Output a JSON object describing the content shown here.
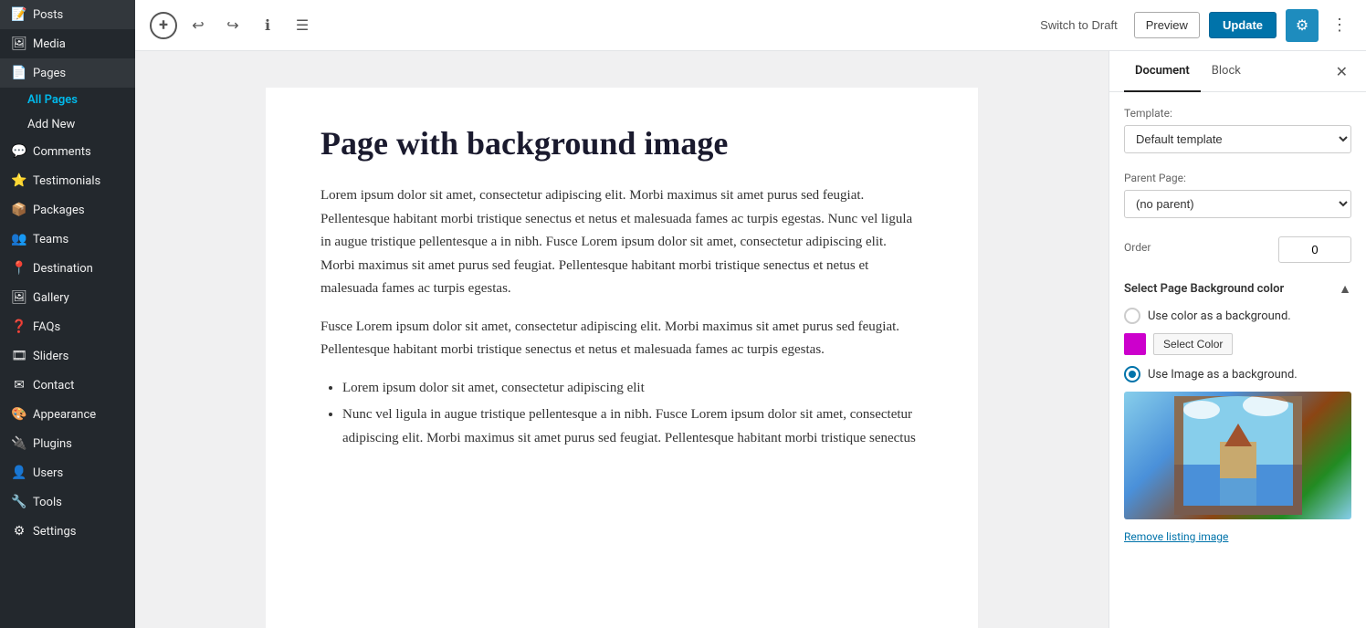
{
  "sidebar": {
    "items": [
      {
        "id": "posts",
        "label": "Posts",
        "icon": "📝"
      },
      {
        "id": "media",
        "label": "Media",
        "icon": "🖼"
      },
      {
        "id": "pages",
        "label": "Pages",
        "icon": "📄",
        "active": true
      },
      {
        "id": "comments",
        "label": "Comments",
        "icon": "💬"
      },
      {
        "id": "testimonials",
        "label": "Testimonials",
        "icon": "⭐"
      },
      {
        "id": "packages",
        "label": "Packages",
        "icon": "📦"
      },
      {
        "id": "teams",
        "label": "Teams",
        "icon": "👥"
      },
      {
        "id": "destination",
        "label": "Destination",
        "icon": "📍"
      },
      {
        "id": "gallery",
        "label": "Gallery",
        "icon": "🖼"
      },
      {
        "id": "faqs",
        "label": "FAQs",
        "icon": "❓"
      },
      {
        "id": "sliders",
        "label": "Sliders",
        "icon": "🎞"
      },
      {
        "id": "contact",
        "label": "Contact",
        "icon": "✉"
      },
      {
        "id": "appearance",
        "label": "Appearance",
        "icon": "🎨"
      },
      {
        "id": "plugins",
        "label": "Plugins",
        "icon": "🔌"
      },
      {
        "id": "users",
        "label": "Users",
        "icon": "👤"
      },
      {
        "id": "tools",
        "label": "Tools",
        "icon": "🔧"
      },
      {
        "id": "settings",
        "label": "Settings",
        "icon": "⚙"
      }
    ],
    "pages_sub": {
      "all_pages": "All Pages",
      "add_new": "Add New"
    }
  },
  "toolbar": {
    "switch_draft_label": "Switch to Draft",
    "preview_label": "Preview",
    "update_label": "Update"
  },
  "editor": {
    "title": "Page with background image",
    "paragraph1": "Lorem ipsum dolor sit amet, consectetur adipiscing elit. Morbi maximus sit amet purus sed feugiat. Pellentesque habitant morbi tristique senectus et netus et malesuada fames ac turpis egestas. Nunc vel ligula in augue tristique pellentesque a in nibh. Fusce Lorem ipsum dolor sit amet, consectetur adipiscing elit. Morbi maximus sit amet purus sed feugiat. Pellentesque habitant morbi tristique senectus et netus et malesuada fames ac turpis egestas.",
    "paragraph2": "Fusce Lorem ipsum dolor sit amet, consectetur adipiscing elit. Morbi maximus sit amet purus sed feugiat. Pellentesque habitant morbi tristique senectus et netus et malesuada fames ac turpis egestas.",
    "list_items": [
      "Lorem ipsum dolor sit amet, consectetur adipiscing elit",
      "Nunc vel ligula in augue tristique pellentesque a in nibh. Fusce Lorem ipsum dolor sit amet, consectetur adipiscing elit. Morbi maximus sit amet purus sed feugiat. Pellentesque habitant morbi tristique senectus"
    ]
  },
  "right_panel": {
    "tab_document": "Document",
    "tab_block": "Block",
    "template_label": "Template:",
    "template_value": "Default template",
    "parent_page_label": "Parent Page:",
    "parent_page_value": "(no parent)",
    "order_label": "Order",
    "order_value": "0",
    "bg_section_title": "Select Page Background color",
    "use_color_label": "Use color as a background.",
    "select_color_label": "Select Color",
    "color_value": "#cc00cc",
    "use_image_label": "Use Image as a background.",
    "remove_image_label": "Remove listing image"
  }
}
